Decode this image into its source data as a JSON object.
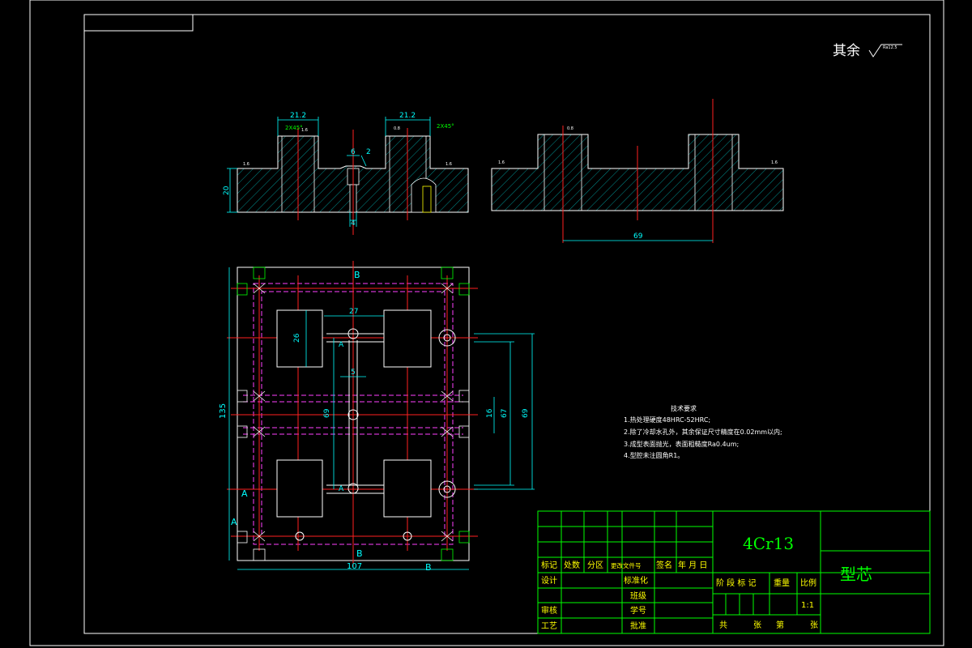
{
  "roughness_note": {
    "prefix": "其余",
    "symbol_value": "Ra12.5"
  },
  "section_top_left": {
    "dims": {
      "left_width": "21.2",
      "right_width": "21.2",
      "hole_d": "6",
      "step": "2",
      "height": "20",
      "bottom_hole": "4"
    },
    "chamfer_left": "2X45°",
    "chamfer_right": "2X45°",
    "roughness": [
      "1.6",
      "0.8",
      "1.6",
      "1.6"
    ]
  },
  "section_top_right": {
    "dims": {
      "span": "69"
    },
    "roughness": [
      "0.8",
      "1.6",
      "1.6"
    ]
  },
  "plan_view": {
    "section_labels": {
      "top": "B",
      "bottom": "B",
      "bottom_right": "B",
      "left_upper": "A",
      "left_lower": "A"
    },
    "dims": {
      "width": "107",
      "height": "135",
      "pocket_spacing": "27",
      "pocket_height": "26",
      "channel_width": "5",
      "inner_span": "69",
      "right_span_outer": "69",
      "right_span_mid": "67",
      "right_small": "16"
    },
    "arrow_marks": [
      "A",
      "A"
    ]
  },
  "tech_requirements": {
    "title": "技术要求",
    "items": [
      "1.热处理硬度48HRC-52HRC;",
      "2.除了冷却水孔外，其余保证尺寸精度在0.02mm以内;",
      "3.成型表面抛光，表面粗糙度Ra0.4um;",
      "4.型腔未注圆角R1。"
    ]
  },
  "title_block": {
    "material": "4Cr13",
    "part_name": "型芯",
    "header_labels": [
      "标记",
      "处数",
      "分区",
      "更改文件号",
      "签名",
      "年 月 日"
    ],
    "left_labels": [
      "设计",
      "审核",
      "工艺"
    ],
    "mid_labels": [
      "标准化",
      "班级",
      "学号",
      "批准"
    ],
    "stage_labels": {
      "stage": "阶 段 标 记",
      "weight": "重量",
      "scale": "比例"
    },
    "scale_value": "1:1",
    "sheet_labels": {
      "total": "共",
      "sheet_unit": "张",
      "number": "第",
      "sheet_unit2": "张"
    }
  },
  "colors": {
    "border": "#ffffff",
    "outline": "#ffffff",
    "dim": "#00ffff",
    "center": "#ff2020",
    "hidden": "#ff40ff",
    "hatch": "#00c8c8",
    "green": "#00ff00",
    "yellow": "#ffff00",
    "title_block": "#00ff00"
  }
}
